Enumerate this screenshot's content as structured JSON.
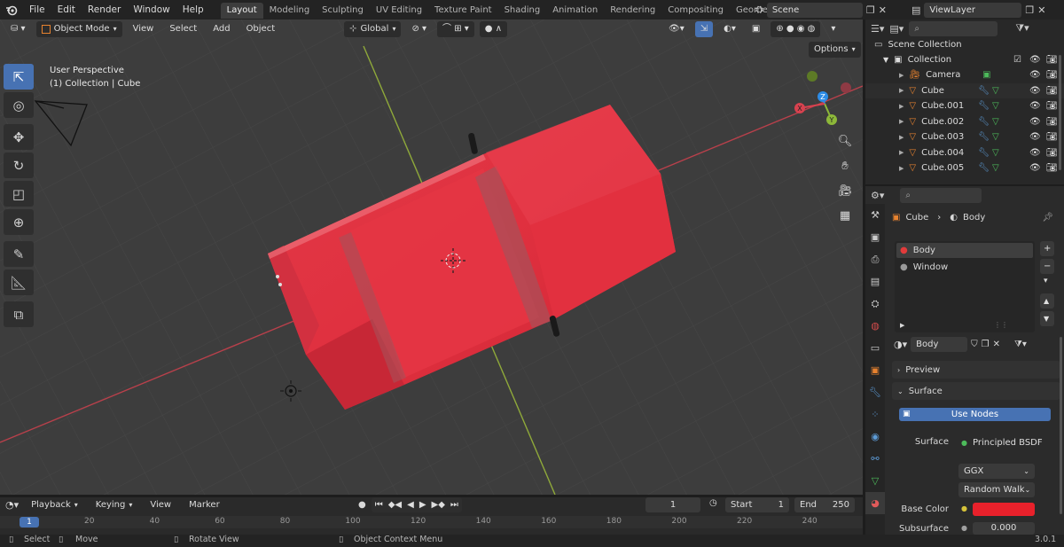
{
  "app": {
    "version": "3.0.1"
  },
  "topbar": {
    "menus": [
      "File",
      "Edit",
      "Render",
      "Window",
      "Help"
    ],
    "workspaces": [
      "Layout",
      "Modeling",
      "Sculpting",
      "UV Editing",
      "Texture Paint",
      "Shading",
      "Animation",
      "Rendering",
      "Compositing",
      "Geometry Nod"
    ],
    "active_workspace": "Layout",
    "scene": "Scene",
    "view_layer": "ViewLayer"
  },
  "viewport": {
    "mode": "Object Mode",
    "menus": [
      "View",
      "Select",
      "Add",
      "Object"
    ],
    "orientation": "Global",
    "options_label": "Options",
    "info_line1": "User Perspective",
    "info_line2": "(1) Collection | Cube",
    "axes": {
      "x": "X",
      "y": "Y",
      "z": "Z"
    }
  },
  "toolbar": {
    "tools": [
      "select-box",
      "cursor",
      "move",
      "rotate",
      "scale",
      "transform",
      "annotate",
      "measure",
      "add-cube"
    ],
    "active_tool": "select-box"
  },
  "outliner": {
    "root": "Scene Collection",
    "collection": "Collection",
    "items": [
      {
        "name": "Camera",
        "type": "camera"
      },
      {
        "name": "Cube",
        "type": "mesh"
      },
      {
        "name": "Cube.001",
        "type": "mesh"
      },
      {
        "name": "Cube.002",
        "type": "mesh"
      },
      {
        "name": "Cube.003",
        "type": "mesh"
      },
      {
        "name": "Cube.004",
        "type": "mesh"
      },
      {
        "name": "Cube.005",
        "type": "mesh"
      }
    ]
  },
  "properties": {
    "breadcrumb_object": "Cube",
    "breadcrumb_material": "Body",
    "material_slots": [
      {
        "name": "Body",
        "selected": true
      },
      {
        "name": "Window",
        "selected": false
      }
    ],
    "material_name": "Body",
    "preview_label": "Preview",
    "surface_label": "Surface",
    "use_nodes_label": "Use Nodes",
    "surface_field_label": "Surface",
    "surface_value": "Principled BSDF",
    "distribution": "GGX",
    "subsurface_method": "Random Walk",
    "base_color_label": "Base Color",
    "base_color": "#e8212b",
    "subsurface_label": "Subsurface",
    "subsurface_value": "0.000"
  },
  "timeline": {
    "menus": [
      "Playback",
      "Keying",
      "View",
      "Marker"
    ],
    "current_frame": "1",
    "start_label": "Start",
    "start_value": "1",
    "end_label": "End",
    "end_value": "250",
    "ruler_current": "1",
    "ruler_ticks": [
      "20",
      "40",
      "60",
      "80",
      "100",
      "120",
      "140",
      "160",
      "180",
      "200",
      "220",
      "240"
    ]
  },
  "statusbar": {
    "select": "Select",
    "move": "Move",
    "rotate_view": "Rotate View",
    "context_menu": "Object Context Menu"
  },
  "colors": {
    "accent": "#4772b3",
    "car_body": "#e0303f",
    "grid_bg": "#3d3d3d",
    "x_axis": "#d8424f",
    "y_axis": "#8db839"
  }
}
